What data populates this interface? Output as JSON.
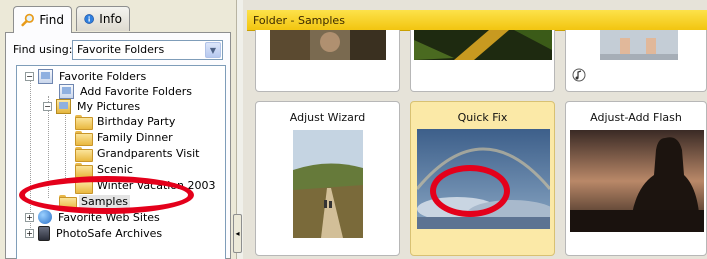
{
  "tabs": [
    {
      "label": "Find",
      "icon": "magnifier-icon",
      "active": true
    },
    {
      "label": "Info",
      "icon": "info-icon",
      "active": false
    }
  ],
  "find_using": {
    "label": "Find using:",
    "value": "Favorite Folders"
  },
  "tree": {
    "favorite_folders": "Favorite Folders",
    "add_favorite_folders": "Add Favorite Folders",
    "my_pictures": "My Pictures",
    "birthday_party": "Birthday Party",
    "family_dinner": "Family Dinner",
    "grandparents_visit": "Grandparents Visit",
    "scenic": "Scenic",
    "winter_vacation": "Winter Vacation 2003",
    "samples": "Samples",
    "hidden_item": "Favorite Web Sites",
    "photosafe": "PhotoSafe Archives"
  },
  "folder_header": "Folder - Samples",
  "cards": [
    {
      "title": "Adjust Wizard"
    },
    {
      "title": "Quick Fix",
      "selected": true
    },
    {
      "title": "Adjust-Add Flash"
    }
  ],
  "colors": {
    "header_yellow": "#f5cc1a",
    "selected_card": "#fbe9a7",
    "annotation_red": "#e4001b"
  }
}
